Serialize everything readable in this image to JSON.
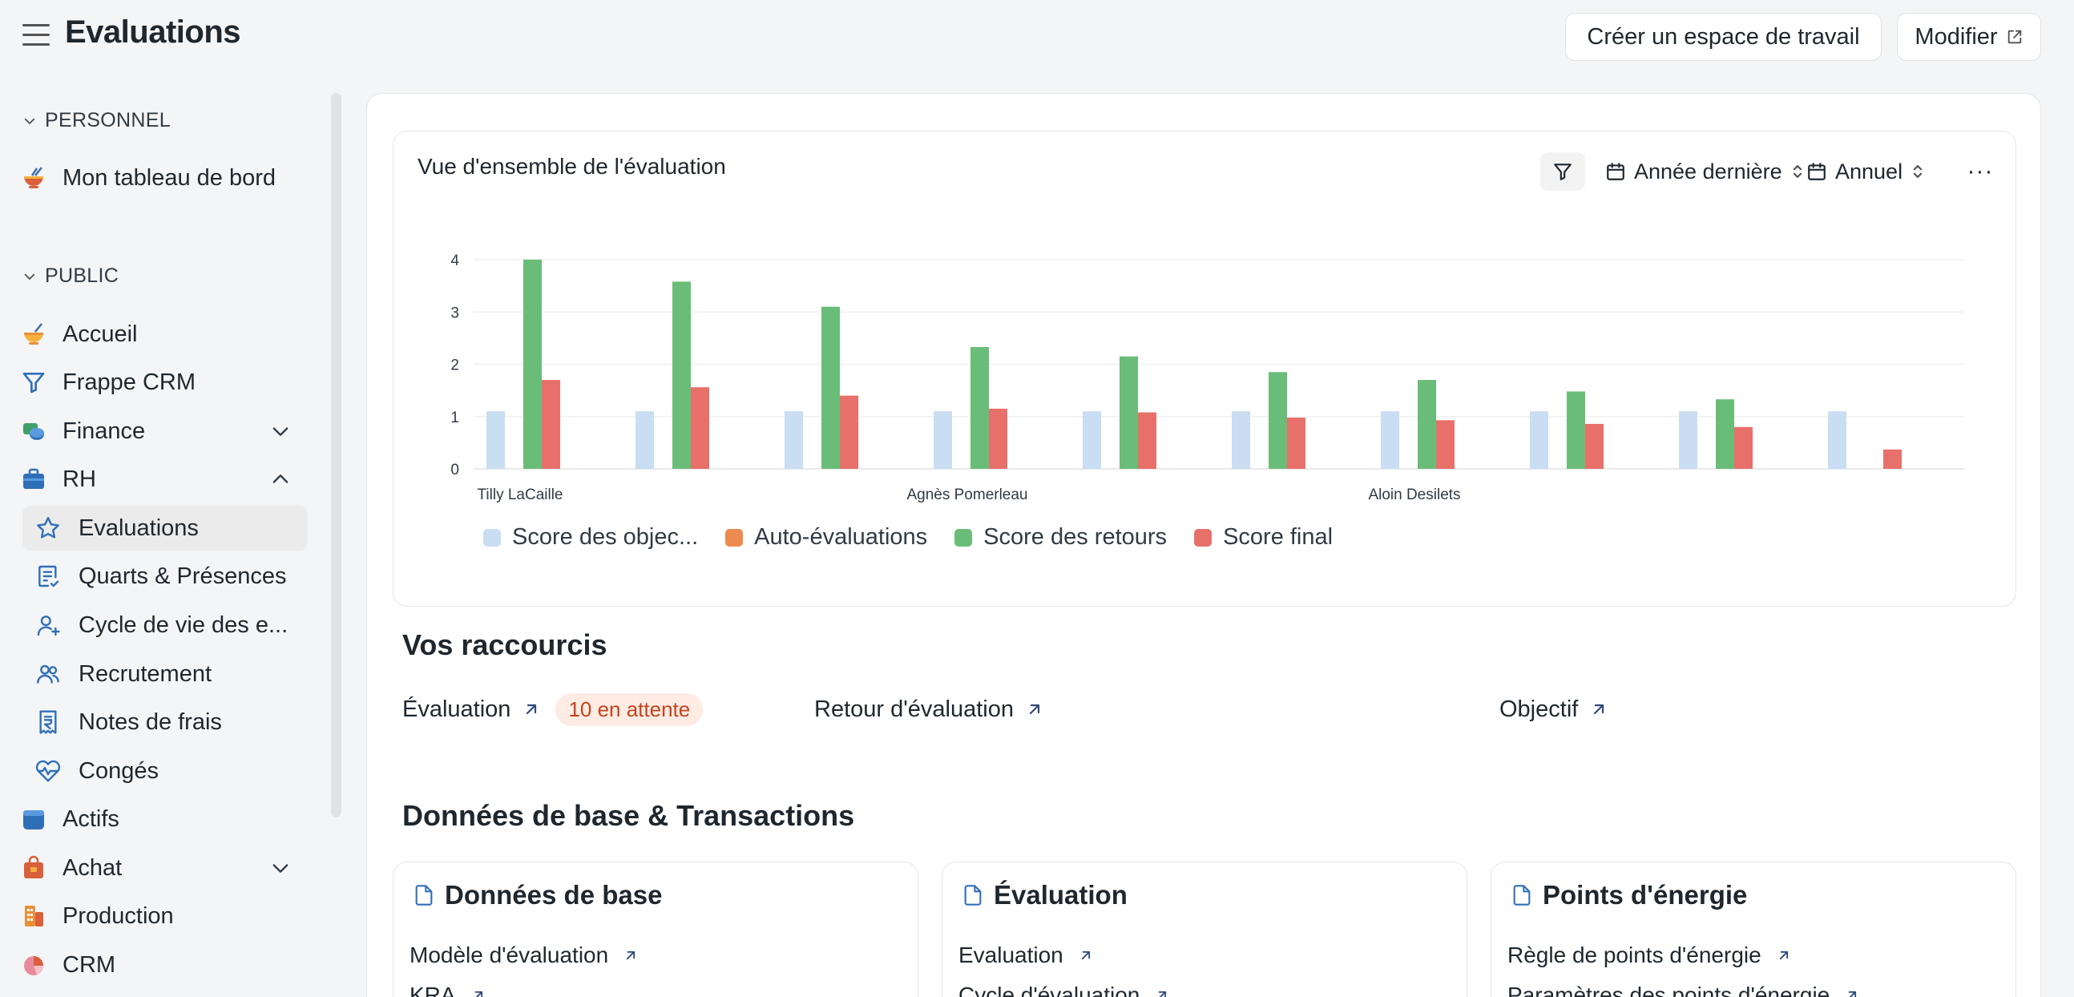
{
  "header": {
    "title": "Evaluations",
    "create_workspace_label": "Créer un espace de travail",
    "edit_label": "Modifier"
  },
  "sidebar": {
    "sections": {
      "personal": "PERSONNEL",
      "public": "PUBLIC"
    },
    "personal_items": [
      {
        "label": "Mon tableau de bord",
        "icon": "bowl-icon"
      }
    ],
    "public_items": [
      {
        "label": "Accueil",
        "icon": "bowl-icon"
      },
      {
        "label": "Frappe CRM",
        "icon": "funnel-icon"
      },
      {
        "label": "Finance",
        "icon": "coins-icon",
        "expandable": true,
        "expanded": false
      },
      {
        "label": "RH",
        "icon": "briefcase-icon",
        "expandable": true,
        "expanded": true
      },
      {
        "label": "Actifs",
        "icon": "box-icon"
      },
      {
        "label": "Achat",
        "icon": "shopping-bag-icon",
        "expandable": true,
        "expanded": false
      },
      {
        "label": "Production",
        "icon": "factory-icon"
      },
      {
        "label": "CRM",
        "icon": "pie-chart-icon"
      }
    ],
    "hr_items": [
      {
        "label": "Evaluations",
        "icon": "star-icon",
        "active": true
      },
      {
        "label": "Quarts & Présences",
        "icon": "checklist-icon"
      },
      {
        "label": "Cycle de vie des e...",
        "icon": "user-plus-icon"
      },
      {
        "label": "Recrutement",
        "icon": "users-icon"
      },
      {
        "label": "Notes de frais",
        "icon": "receipt-icon"
      },
      {
        "label": "Congés",
        "icon": "heart-pulse-icon"
      }
    ]
  },
  "chart_card": {
    "title": "Vue d'ensemble de l'évaluation",
    "year_filter": "Année dernière",
    "period_filter": "Annuel",
    "more_label": "···"
  },
  "chart_data": {
    "type": "bar",
    "categories": [
      "Tilly LaCaille",
      "",
      "",
      "Agnès Pomerleau",
      "",
      "",
      "Aloin Desilets",
      "",
      "",
      ""
    ],
    "yticks": [
      0,
      1,
      2,
      3,
      4
    ],
    "ylim": [
      0,
      4
    ],
    "series": [
      {
        "name": "Score des objec...",
        "color": "#c9ddf3",
        "values": [
          1.1,
          1.1,
          1.1,
          1.1,
          1.1,
          1.1,
          1.1,
          1.1,
          1.1,
          1.1
        ]
      },
      {
        "name": "Auto-évaluations",
        "color": "#ec8a4f",
        "values": [
          0,
          0,
          0,
          0,
          0,
          0,
          0,
          0,
          0,
          0
        ]
      },
      {
        "name": "Score des retours",
        "color": "#6abd78",
        "values": [
          4.0,
          3.58,
          3.1,
          2.33,
          2.15,
          1.85,
          1.7,
          1.48,
          1.33,
          0
        ]
      },
      {
        "name": "Score final",
        "color": "#e8706a",
        "values": [
          1.7,
          1.56,
          1.4,
          1.15,
          1.08,
          0.98,
          0.93,
          0.86,
          0.8,
          0.37
        ]
      }
    ]
  },
  "shortcuts": {
    "title": "Vos raccourcis",
    "items": [
      {
        "label": "Évaluation",
        "badge": "10 en attente"
      },
      {
        "label": "Retour d'évaluation"
      },
      {
        "label": "Objectif"
      }
    ]
  },
  "masters": {
    "title": "Données de base & Transactions",
    "cards": [
      {
        "title": "Données de base",
        "links": [
          "Modèle d'évaluation",
          "KRA"
        ]
      },
      {
        "title": "Évaluation",
        "links": [
          "Evaluation",
          "Cycle d'évaluation"
        ]
      },
      {
        "title": "Points d'énergie",
        "links": [
          "Règle de points d'énergie",
          "Paramètres des points d'énergie"
        ]
      }
    ]
  }
}
